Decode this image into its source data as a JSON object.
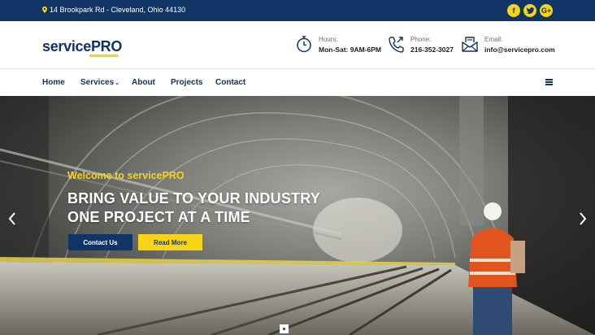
{
  "topbar": {
    "address": "14 Brookpark Rd - Cleveland, Ohio 44130",
    "social": [
      {
        "icon": "facebook-icon",
        "glyph": "f"
      },
      {
        "icon": "twitter-icon",
        "glyph": "t"
      },
      {
        "icon": "google-plus-icon",
        "glyph": "G+"
      }
    ]
  },
  "header": {
    "logo": {
      "service": "service",
      "pro": "PRO"
    },
    "hours": {
      "label": "Hours:",
      "value": "Mon-Sat: 9AM-6PM"
    },
    "phone": {
      "label": "Phone:",
      "value": "216-352-3027"
    },
    "email": {
      "label": "Email:",
      "value": "info@servicepro.com"
    }
  },
  "nav": {
    "items": [
      "Home",
      "Services",
      "About",
      "Projects",
      "Contact"
    ]
  },
  "hero": {
    "welcome": "Welcome to servicePRO",
    "line1": "BRING VALUE TO YOUR INDUSTRY",
    "line2": "ONE PROJECT AT A TIME",
    "contact_button": "Contact Us",
    "more_button": "Read More"
  },
  "colors": {
    "brand_navy": "#0f3465",
    "accent_yellow": "#f7d418"
  }
}
